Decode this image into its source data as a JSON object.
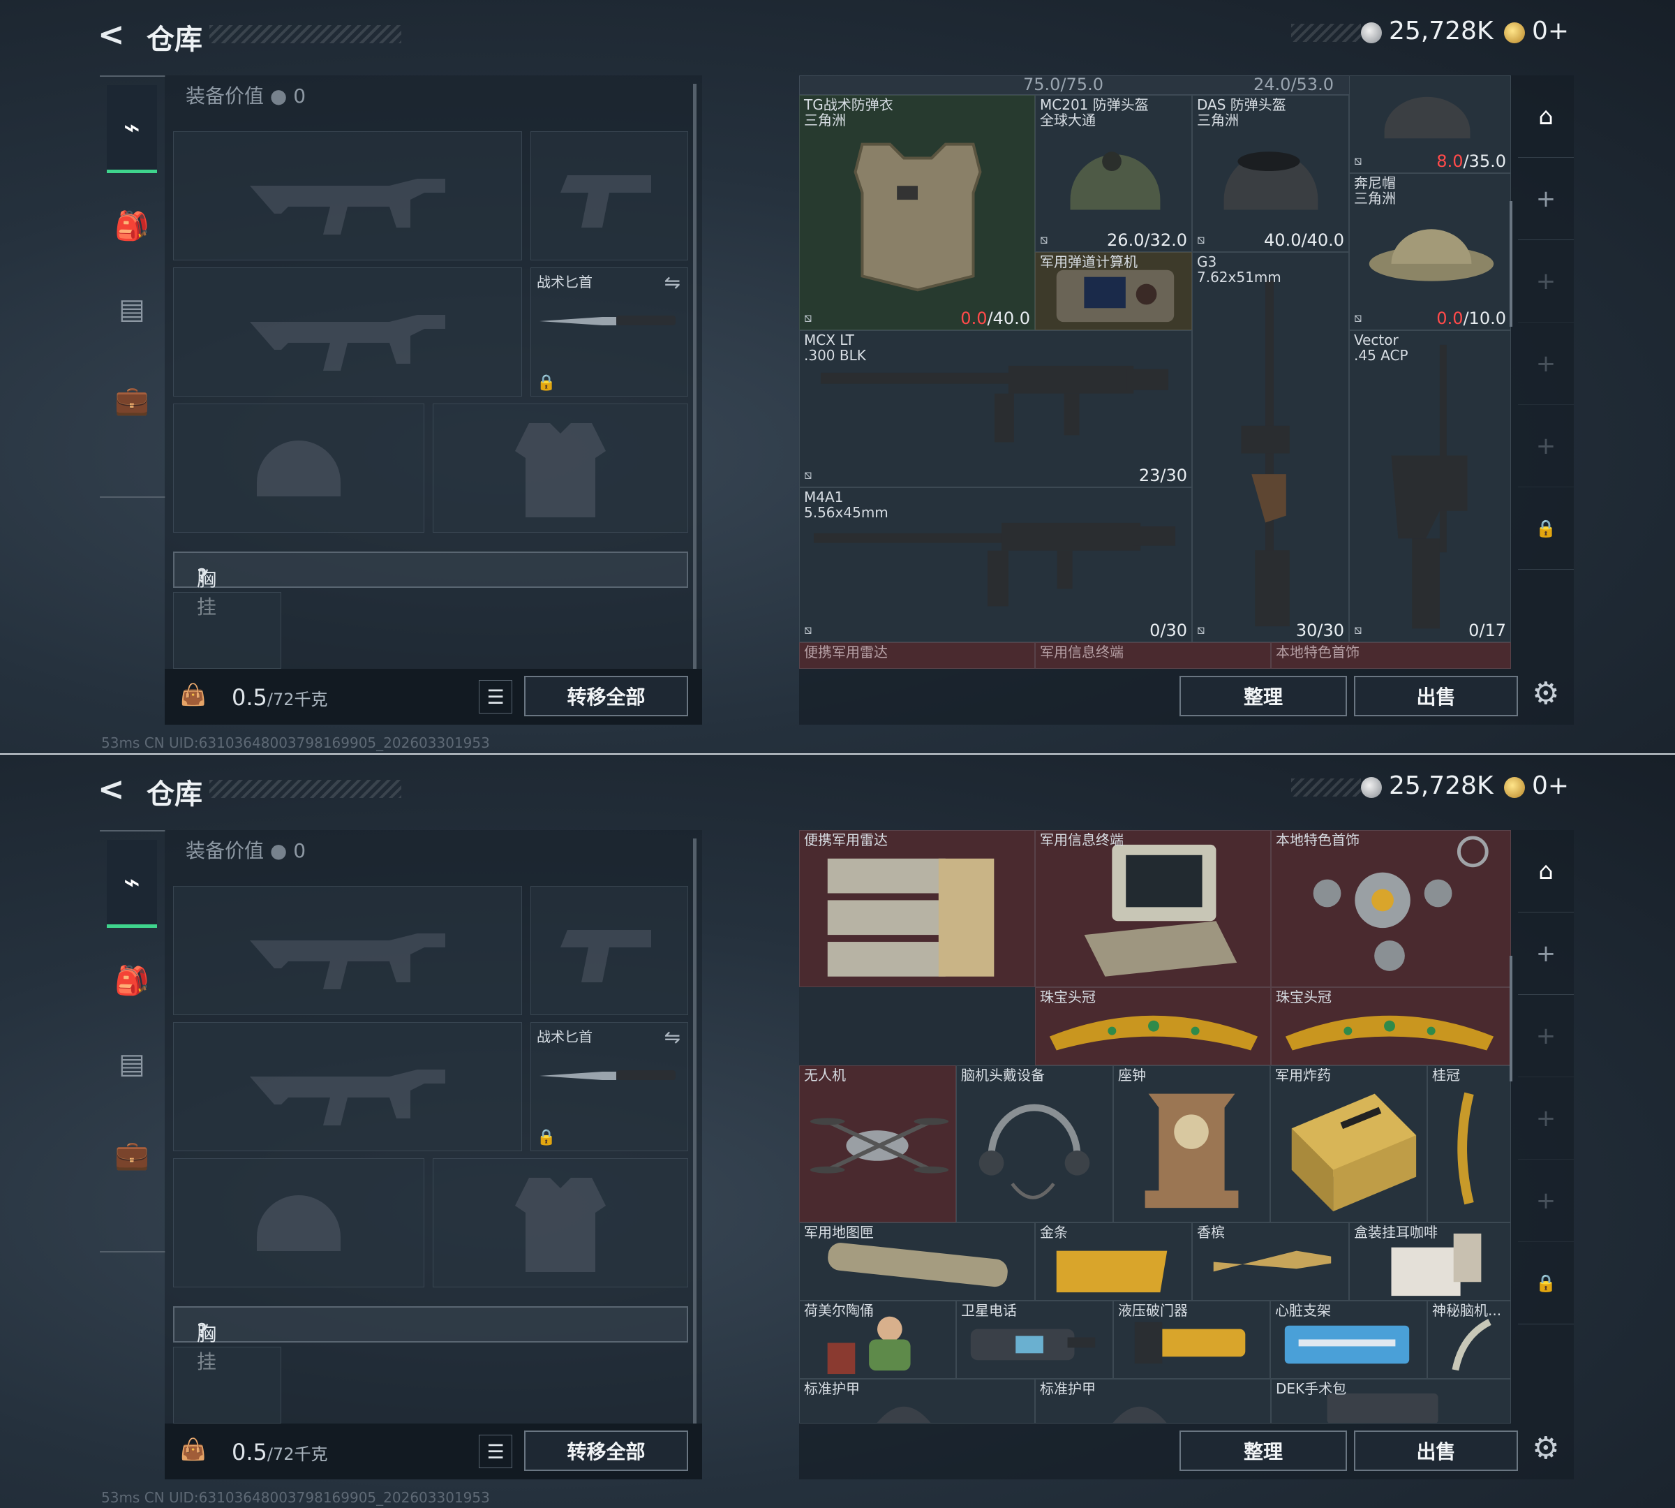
{
  "header": {
    "back": "<",
    "title": "仓库",
    "silver": "25,728K",
    "gold": "0+"
  },
  "loadout": {
    "equip_value_label": "装备价值",
    "equip_value": "0",
    "knife": "战术匕首",
    "chest_rig": "胸挂",
    "chest_help": "?",
    "weight": "0.5",
    "weight_max": "/72千克",
    "transfer_all": "转移全部"
  },
  "status": "53ms     CN UID:6310364800379816990​5_202603301953",
  "stash_buttons": {
    "sort": "整理",
    "sell": "出售"
  },
  "screen1": {
    "topstrip": [
      "75.0/75.0",
      "24.0/53.0"
    ],
    "items": [
      {
        "name": "TG战术防弹衣\n三角洲",
        "dur_red": "0.0",
        "dur_rest": "/40.0"
      },
      {
        "name": "MC201 防弹头盔\n全球大通",
        "dur": "26.0/32.0"
      },
      {
        "name": "DAS 防弹头盔\n三角洲",
        "dur": "40.0/40.0"
      },
      {
        "name": "",
        "dur_red": "8.0",
        "dur_rest": "/35.0"
      },
      {
        "name": "军用弹道计算机"
      },
      {
        "name": "G3\n7.62x51mm",
        "dur": "30/30"
      },
      {
        "name": "奔尼帽\n三角洲",
        "dur_red": "0.0",
        "dur_rest": "/10.0"
      },
      {
        "name": "MCX LT\n.300 BLK",
        "dur": "23/30"
      },
      {
        "name": "Vector\n.45 ACP",
        "dur": "0/17"
      },
      {
        "name": "M4A1\n5.56x45mm",
        "dur": "0/30"
      },
      {
        "name": "便携军用雷达"
      },
      {
        "name": "军用信息终端"
      },
      {
        "name": "本地特色首饰"
      }
    ]
  },
  "screen2": {
    "items": [
      {
        "name": "便携军用雷达"
      },
      {
        "name": "军用信息终端"
      },
      {
        "name": "本地特色首饰"
      },
      {
        "name": "珠宝头冠"
      },
      {
        "name": "珠宝头冠"
      },
      {
        "name": "无人机"
      },
      {
        "name": "脑机头戴设备"
      },
      {
        "name": "座钟"
      },
      {
        "name": "军用炸药"
      },
      {
        "name": "桂冠"
      },
      {
        "name": "军用地图匣"
      },
      {
        "name": "金条"
      },
      {
        "name": "香槟"
      },
      {
        "name": "盒装挂耳咖啡"
      },
      {
        "name": "荷美尔陶俑"
      },
      {
        "name": "卫星电话"
      },
      {
        "name": "液压破门器"
      },
      {
        "name": "心脏支架"
      },
      {
        "name": "神秘脑机..."
      },
      {
        "name": "标准护甲"
      },
      {
        "name": "标准护甲"
      },
      {
        "name": "DEK手术包"
      }
    ]
  }
}
